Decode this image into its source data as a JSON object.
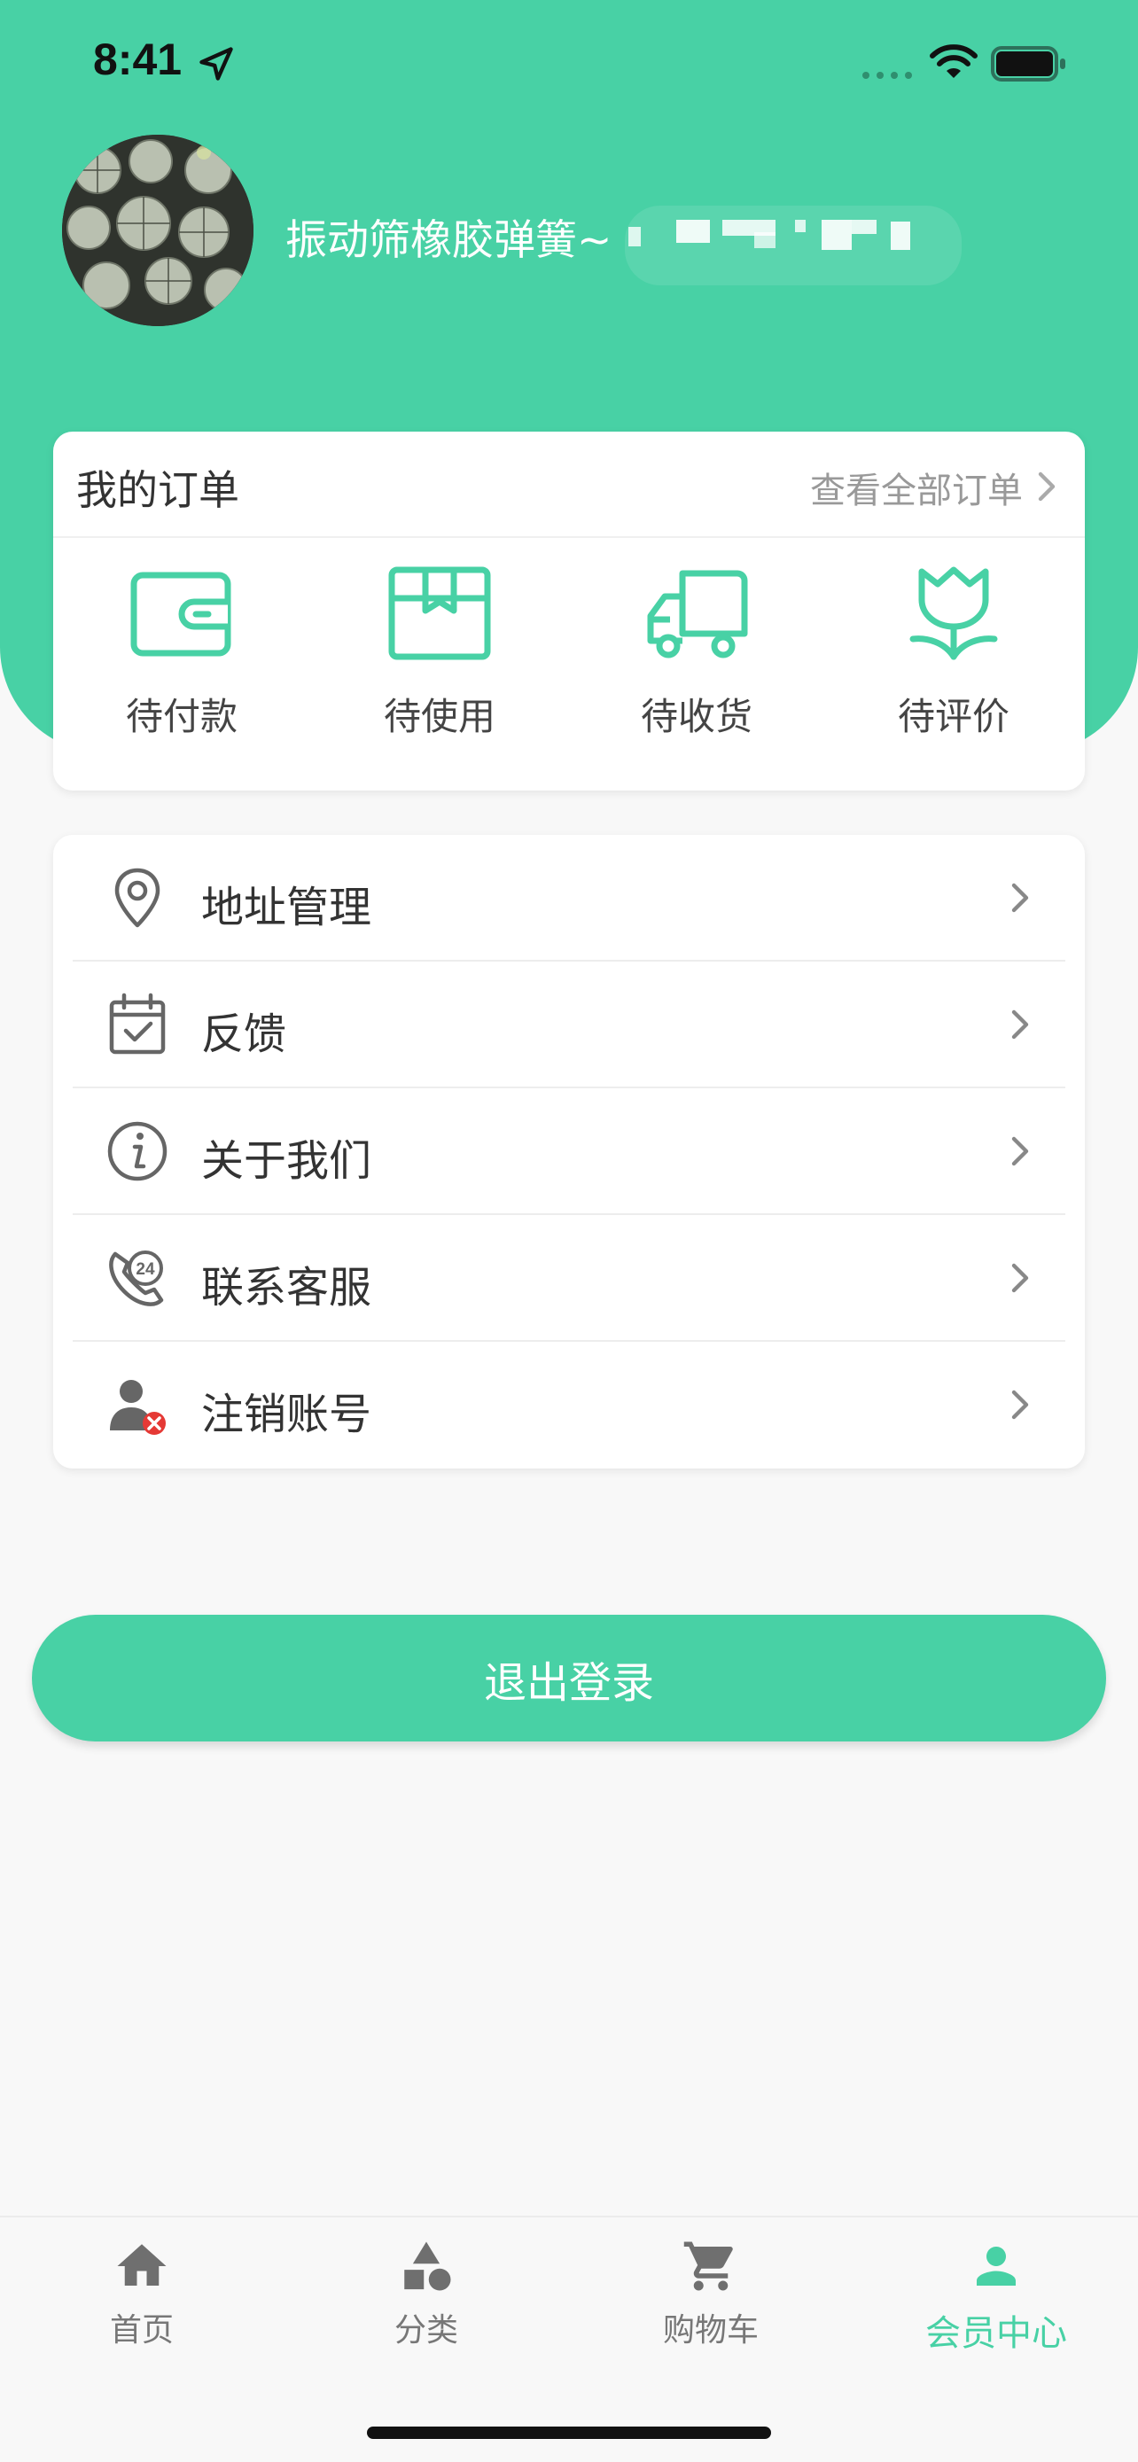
{
  "status_bar": {
    "time": "8:41"
  },
  "profile": {
    "nickname": "振动筛橡胶弹簧~"
  },
  "orders": {
    "title": "我的订单",
    "view_all": "查看全部订单",
    "items": [
      {
        "label": "待付款",
        "icon": "wallet-icon"
      },
      {
        "label": "待使用",
        "icon": "package-icon"
      },
      {
        "label": "待收货",
        "icon": "truck-icon"
      },
      {
        "label": "待评价",
        "icon": "tulip-icon"
      }
    ]
  },
  "menu": {
    "items": [
      {
        "label": "地址管理",
        "icon": "location-pin-icon"
      },
      {
        "label": "反馈",
        "icon": "calendar-check-icon"
      },
      {
        "label": "关于我们",
        "icon": "info-icon"
      },
      {
        "label": "联系客服",
        "icon": "phone-24-icon"
      },
      {
        "label": "注销账号",
        "icon": "user-remove-icon"
      }
    ]
  },
  "logout": {
    "label": "退出登录"
  },
  "tabbar": {
    "items": [
      {
        "label": "首页",
        "icon": "home-icon"
      },
      {
        "label": "分类",
        "icon": "category-shapes-icon"
      },
      {
        "label": "购物车",
        "icon": "cart-icon"
      },
      {
        "label": "会员中心",
        "icon": "person-icon",
        "active": true
      }
    ]
  },
  "colors": {
    "accent": "#48d1a5",
    "background": "#f8f8f8",
    "text_primary": "#333333",
    "text_secondary": "#999999",
    "danger": "#e53935"
  }
}
